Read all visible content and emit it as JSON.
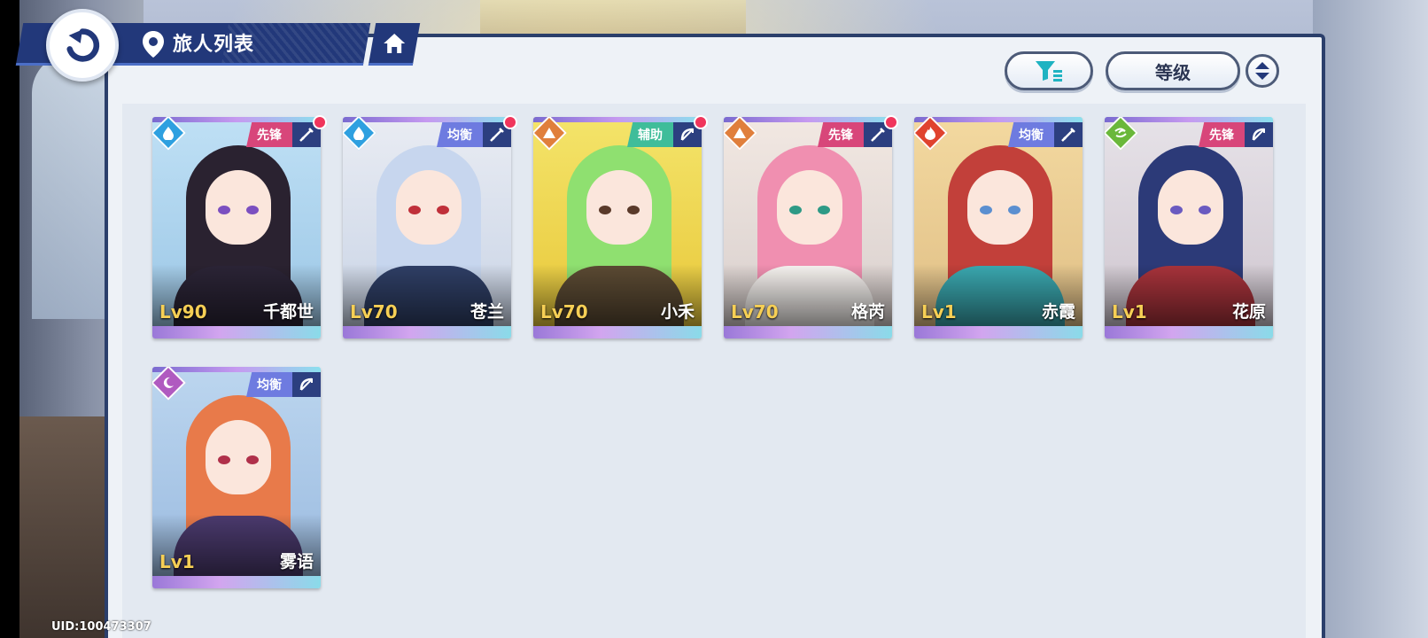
{
  "header": {
    "title": "旅人列表"
  },
  "toolbar": {
    "sort_label": "等级"
  },
  "colors": {
    "vanguard": "#d8467a",
    "balance": "#6e7be0",
    "support": "#3fbd9a",
    "water": "#2ea0e0",
    "earth": "#e07f3c",
    "fire": "#e0432f",
    "wind": "#6ab83a",
    "moon": "#b05ac0"
  },
  "characters": [
    {
      "name": "千都世",
      "level": "Lv90",
      "role": "先锋",
      "element": "water-icon",
      "weapon": "sword-icon",
      "new": true
    },
    {
      "name": "苍兰",
      "level": "Lv70",
      "role": "均衡",
      "element": "water-icon",
      "weapon": "sword-icon",
      "new": true
    },
    {
      "name": "小禾",
      "level": "Lv70",
      "role": "辅助",
      "element": "earth-icon",
      "weapon": "bow-icon",
      "new": true
    },
    {
      "name": "格芮",
      "level": "Lv70",
      "role": "先锋",
      "element": "earth-icon",
      "weapon": "sword-icon",
      "new": true
    },
    {
      "name": "赤霞",
      "level": "Lv1",
      "role": "均衡",
      "element": "fire-icon",
      "weapon": "sword-icon",
      "new": false
    },
    {
      "name": "花原",
      "level": "Lv1",
      "role": "先锋",
      "element": "wind-icon",
      "weapon": "bow-icon",
      "new": false
    },
    {
      "name": "雾语",
      "level": "Lv1",
      "role": "均衡",
      "element": "moon-icon",
      "weapon": "bow-icon",
      "new": false
    }
  ],
  "footer": {
    "uid": "UID:100473307"
  }
}
